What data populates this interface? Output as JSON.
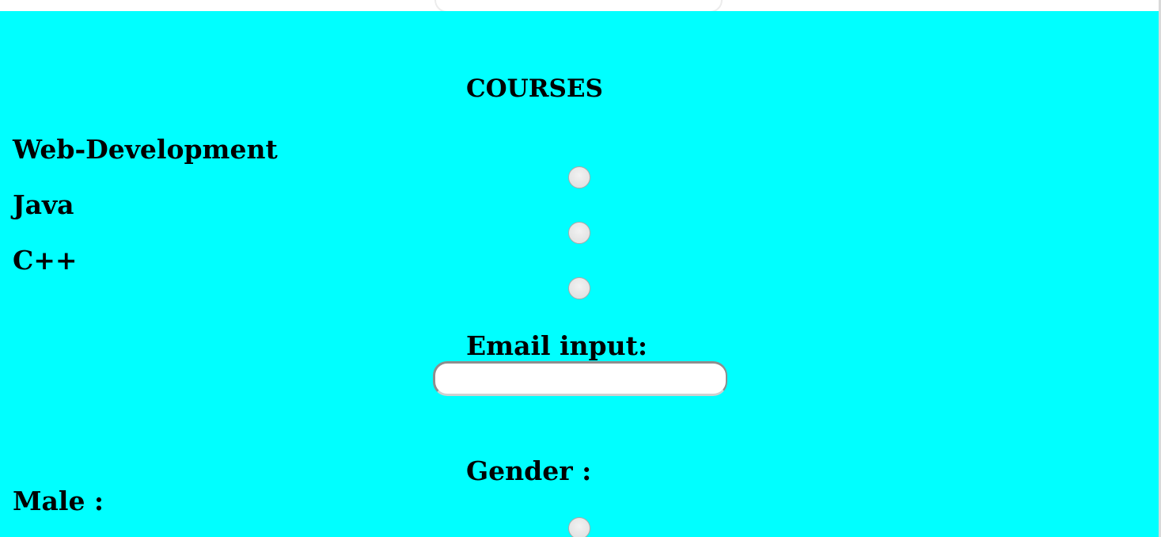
{
  "colors": {
    "form_background": "#00ffff",
    "text": "#000000",
    "input_background": "#ffffff"
  },
  "courses": {
    "title": "COURSES",
    "options": [
      {
        "label": "Web-Development"
      },
      {
        "label": "Java"
      },
      {
        "label": "C++"
      }
    ]
  },
  "email": {
    "label": "Email input:",
    "value": "",
    "placeholder": ""
  },
  "gender": {
    "title": "Gender :",
    "options": [
      {
        "label": "Male :"
      }
    ]
  }
}
